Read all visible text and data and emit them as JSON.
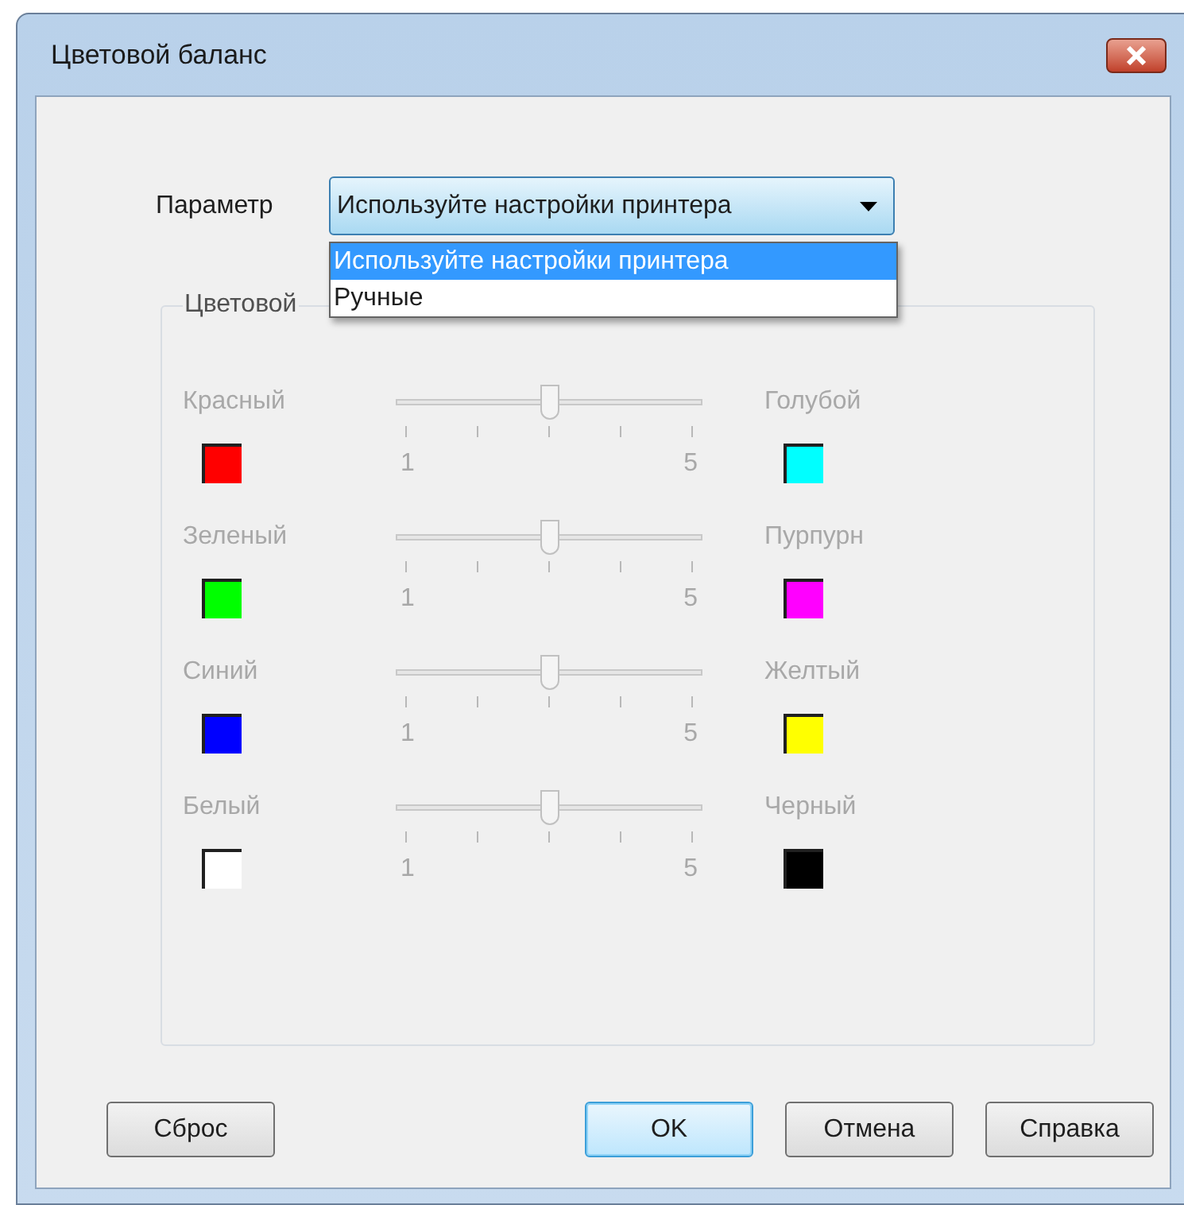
{
  "window": {
    "title": "Цветовой баланс"
  },
  "parameter": {
    "label": "Параметр",
    "value": "Используйте настройки принтера",
    "open": true,
    "options": [
      {
        "label": "Используйте настройки принтера",
        "selected": true
      },
      {
        "label": "Ручные",
        "selected": false
      }
    ]
  },
  "group": {
    "legend": "Цветовой",
    "disabled": true,
    "rows": [
      {
        "left": {
          "name": "Красный",
          "color": "#ff0000"
        },
        "right": {
          "name": "Голубой",
          "color": "#00ffff"
        },
        "level": 0.5,
        "min": "1",
        "max": "5"
      },
      {
        "left": {
          "name": "Зеленый",
          "color": "#00ff00"
        },
        "right": {
          "name": "Пурпурн",
          "color": "#ff00ff"
        },
        "level": 0.5,
        "min": "1",
        "max": "5"
      },
      {
        "left": {
          "name": "Синий",
          "color": "#0000ff"
        },
        "right": {
          "name": "Желтый",
          "color": "#ffff00"
        },
        "level": 0.5,
        "min": "1",
        "max": "5"
      },
      {
        "left": {
          "name": "Белый",
          "color": "#ffffff"
        },
        "right": {
          "name": "Черный",
          "color": "#000000"
        },
        "level": 0.5,
        "min": "1",
        "max": "5"
      }
    ]
  },
  "buttons": [
    {
      "label": "Сброс",
      "default": false
    },
    {
      "label": "OK",
      "default": true
    },
    {
      "label": "Отмена",
      "default": false
    },
    {
      "label": "Справка",
      "default": false
    }
  ]
}
